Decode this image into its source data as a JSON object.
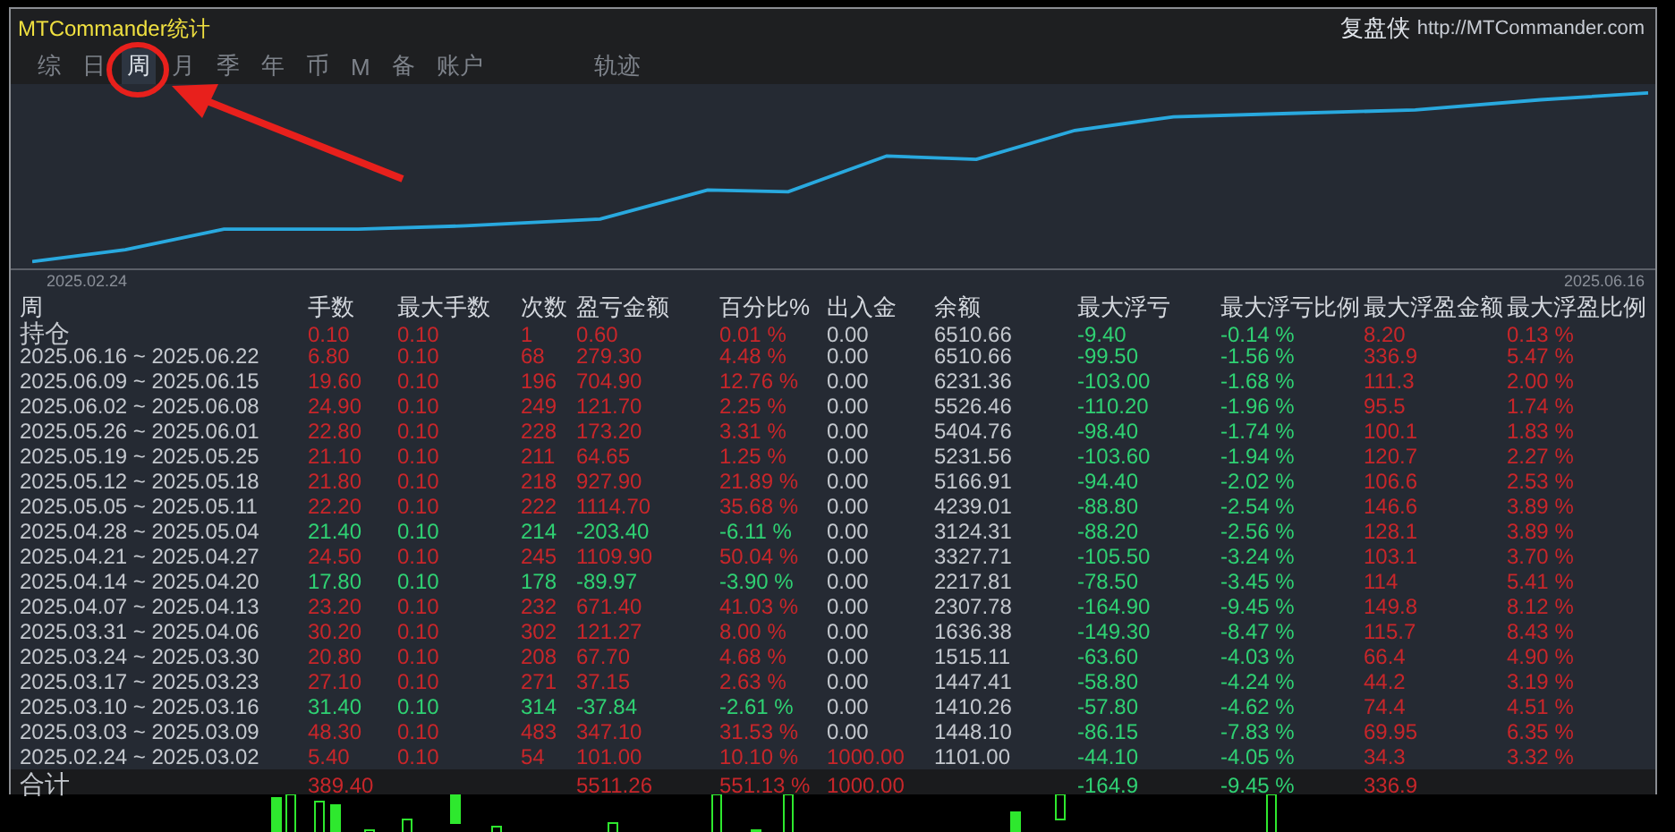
{
  "window": {
    "title": "MTCommander统计",
    "brand": "复盘侠",
    "link": "http://MTCommander.com"
  },
  "tabs": [
    {
      "label": "综",
      "selected": false
    },
    {
      "label": "日",
      "selected": false
    },
    {
      "label": "周",
      "selected": true
    },
    {
      "label": "月",
      "selected": false
    },
    {
      "label": "季",
      "selected": false
    },
    {
      "label": "年",
      "selected": false
    },
    {
      "label": "币",
      "selected": false
    },
    {
      "label": "M",
      "selected": false
    },
    {
      "label": "备",
      "selected": false
    },
    {
      "label": "账户",
      "selected": false
    },
    {
      "label": "轨迹",
      "selected": false
    }
  ],
  "chart": {
    "start_label": "2025.02.24",
    "end_label": "2025.06.16"
  },
  "table": {
    "columns": [
      "周",
      "手数",
      "最大手数",
      "次数",
      "盈亏金额",
      "百分比%",
      "出入金",
      "余额",
      "最大浮亏",
      "最大浮亏比例",
      "最大浮盈金额",
      "最大浮盈比例"
    ],
    "rows": [
      {
        "kind": "gain",
        "deposit_marked": false,
        "cells": [
          "持仓",
          "0.10",
          "0.10",
          "1",
          "0.60",
          "0.01 %",
          "0.00",
          "6510.66",
          "-9.40",
          "-0.14 %",
          "8.20",
          "0.13 %"
        ]
      },
      {
        "kind": "gain",
        "deposit_marked": false,
        "cells": [
          "2025.06.16 ~ 2025.06.22",
          "6.80",
          "0.10",
          "68",
          "279.30",
          "4.48 %",
          "0.00",
          "6510.66",
          "-99.50",
          "-1.56 %",
          "336.9",
          "5.47 %"
        ]
      },
      {
        "kind": "gain",
        "deposit_marked": false,
        "cells": [
          "2025.06.09 ~ 2025.06.15",
          "19.60",
          "0.10",
          "196",
          "704.90",
          "12.76 %",
          "0.00",
          "6231.36",
          "-103.00",
          "-1.68 %",
          "111.3",
          "2.00 %"
        ]
      },
      {
        "kind": "gain",
        "deposit_marked": false,
        "cells": [
          "2025.06.02 ~ 2025.06.08",
          "24.90",
          "0.10",
          "249",
          "121.70",
          "2.25 %",
          "0.00",
          "5526.46",
          "-110.20",
          "-1.96 %",
          "95.5",
          "1.74 %"
        ]
      },
      {
        "kind": "gain",
        "deposit_marked": false,
        "cells": [
          "2025.05.26 ~ 2025.06.01",
          "22.80",
          "0.10",
          "228",
          "173.20",
          "3.31 %",
          "0.00",
          "5404.76",
          "-98.40",
          "-1.74 %",
          "100.1",
          "1.83 %"
        ]
      },
      {
        "kind": "gain",
        "deposit_marked": false,
        "cells": [
          "2025.05.19 ~ 2025.05.25",
          "21.10",
          "0.10",
          "211",
          "64.65",
          "1.25 %",
          "0.00",
          "5231.56",
          "-103.60",
          "-1.94 %",
          "120.7",
          "2.27 %"
        ]
      },
      {
        "kind": "gain",
        "deposit_marked": false,
        "cells": [
          "2025.05.12 ~ 2025.05.18",
          "21.80",
          "0.10",
          "218",
          "927.90",
          "21.89 %",
          "0.00",
          "5166.91",
          "-94.40",
          "-2.02 %",
          "106.6",
          "2.53 %"
        ]
      },
      {
        "kind": "gain",
        "deposit_marked": false,
        "cells": [
          "2025.05.05 ~ 2025.05.11",
          "22.20",
          "0.10",
          "222",
          "1114.70",
          "35.68 %",
          "0.00",
          "4239.01",
          "-88.80",
          "-2.54 %",
          "146.6",
          "3.89 %"
        ]
      },
      {
        "kind": "loss",
        "deposit_marked": false,
        "cells": [
          "2025.04.28 ~ 2025.05.04",
          "21.40",
          "0.10",
          "214",
          "-203.40",
          "-6.11 %",
          "0.00",
          "3124.31",
          "-88.20",
          "-2.56 %",
          "128.1",
          "3.89 %"
        ]
      },
      {
        "kind": "gain",
        "deposit_marked": false,
        "cells": [
          "2025.04.21 ~ 2025.04.27",
          "24.50",
          "0.10",
          "245",
          "1109.90",
          "50.04 %",
          "0.00",
          "3327.71",
          "-105.50",
          "-3.24 %",
          "103.1",
          "3.70 %"
        ]
      },
      {
        "kind": "loss",
        "deposit_marked": false,
        "cells": [
          "2025.04.14 ~ 2025.04.20",
          "17.80",
          "0.10",
          "178",
          "-89.97",
          "-3.90 %",
          "0.00",
          "2217.81",
          "-78.50",
          "-3.45 %",
          "114",
          "5.41 %"
        ]
      },
      {
        "kind": "gain",
        "deposit_marked": false,
        "cells": [
          "2025.04.07 ~ 2025.04.13",
          "23.20",
          "0.10",
          "232",
          "671.40",
          "41.03 %",
          "0.00",
          "2307.78",
          "-164.90",
          "-9.45 %",
          "149.8",
          "8.12 %"
        ]
      },
      {
        "kind": "gain",
        "deposit_marked": false,
        "cells": [
          "2025.03.31 ~ 2025.04.06",
          "30.20",
          "0.10",
          "302",
          "121.27",
          "8.00 %",
          "0.00",
          "1636.38",
          "-149.30",
          "-8.47 %",
          "115.7",
          "8.43 %"
        ]
      },
      {
        "kind": "gain",
        "deposit_marked": false,
        "cells": [
          "2025.03.24 ~ 2025.03.30",
          "20.80",
          "0.10",
          "208",
          "67.70",
          "4.68 %",
          "0.00",
          "1515.11",
          "-63.60",
          "-4.03 %",
          "66.4",
          "4.90 %"
        ]
      },
      {
        "kind": "gain",
        "deposit_marked": false,
        "cells": [
          "2025.03.17 ~ 2025.03.23",
          "27.10",
          "0.10",
          "271",
          "37.15",
          "2.63 %",
          "0.00",
          "1447.41",
          "-58.80",
          "-4.24 %",
          "44.2",
          "3.19 %"
        ]
      },
      {
        "kind": "loss",
        "deposit_marked": false,
        "cells": [
          "2025.03.10 ~ 2025.03.16",
          "31.40",
          "0.10",
          "314",
          "-37.84",
          "-2.61 %",
          "0.00",
          "1410.26",
          "-57.80",
          "-4.62 %",
          "74.4",
          "4.51 %"
        ]
      },
      {
        "kind": "gain",
        "deposit_marked": false,
        "cells": [
          "2025.03.03 ~ 2025.03.09",
          "48.30",
          "0.10",
          "483",
          "347.10",
          "31.53 %",
          "0.00",
          "1448.10",
          "-86.15",
          "-7.83 %",
          "69.95",
          "6.35 %"
        ]
      },
      {
        "kind": "gain",
        "deposit_marked": true,
        "cells": [
          "2025.02.24 ~ 2025.03.02",
          "5.40",
          "0.10",
          "54",
          "101.00",
          "10.10 %",
          "1000.00",
          "1101.00",
          "-44.10",
          "-4.05 %",
          "34.3",
          "3.32 %"
        ]
      }
    ],
    "total": {
      "label": "合计",
      "lots": "389.40",
      "pnl": "5511.26",
      "percent": "551.13 %",
      "deposit": "1000.00",
      "max_float_loss": "-164.9",
      "max_float_loss_pct": "-9.45 %",
      "max_float_profit": "336.9"
    }
  }
}
